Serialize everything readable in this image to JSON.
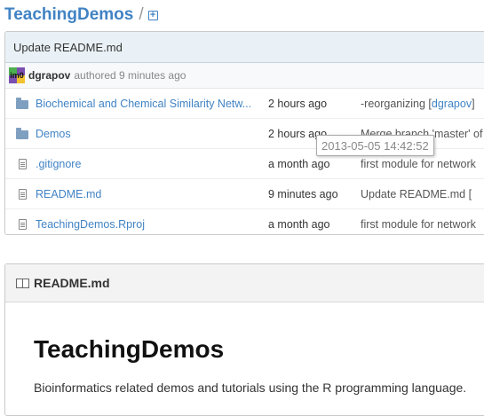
{
  "repo": {
    "name": "TeachingDemos",
    "separator": "/",
    "new_file_icon": "plus-file-icon"
  },
  "latest_commit": {
    "message": "Update README.md",
    "author": "dgrapov",
    "authored_text": "authored 9 minutes ago",
    "avatar_text": "im0"
  },
  "files": [
    {
      "type": "folder",
      "icon": "folder-icon",
      "name": "Biochemical and Chemical Similarity Netw...",
      "age": "2 hours ago",
      "message": "-reorganizing [",
      "message_link": "dgrapov",
      "message_tail": "]"
    },
    {
      "type": "folder",
      "icon": "folder-icon",
      "name": "Demos",
      "age": "2 hours ago",
      "message": "Merge branch 'master' of",
      "message_link": "",
      "message_tail": ""
    },
    {
      "type": "file",
      "icon": "file-icon",
      "name": ".gitignore",
      "age": "a month ago",
      "message": "first module for network",
      "message_link": "",
      "message_tail": ""
    },
    {
      "type": "file",
      "icon": "file-icon",
      "name": "README.md",
      "age": "9 minutes ago",
      "message": "Update README.md [",
      "message_link": "",
      "message_tail": ""
    },
    {
      "type": "file",
      "icon": "file-icon",
      "name": "TeachingDemos.Rproj",
      "age": "a month ago",
      "message": "first module for network",
      "message_link": "",
      "message_tail": ""
    }
  ],
  "tooltip": {
    "text": "2013-05-05 14:42:52"
  },
  "readme": {
    "filename": "README.md",
    "title": "TeachingDemos",
    "description": "Bioinformatics related demos and tutorials using the R programming language."
  },
  "colors": {
    "link": "#4183c4",
    "commit_bar": "#e9f1f6",
    "folder": "#7f9fc0"
  }
}
